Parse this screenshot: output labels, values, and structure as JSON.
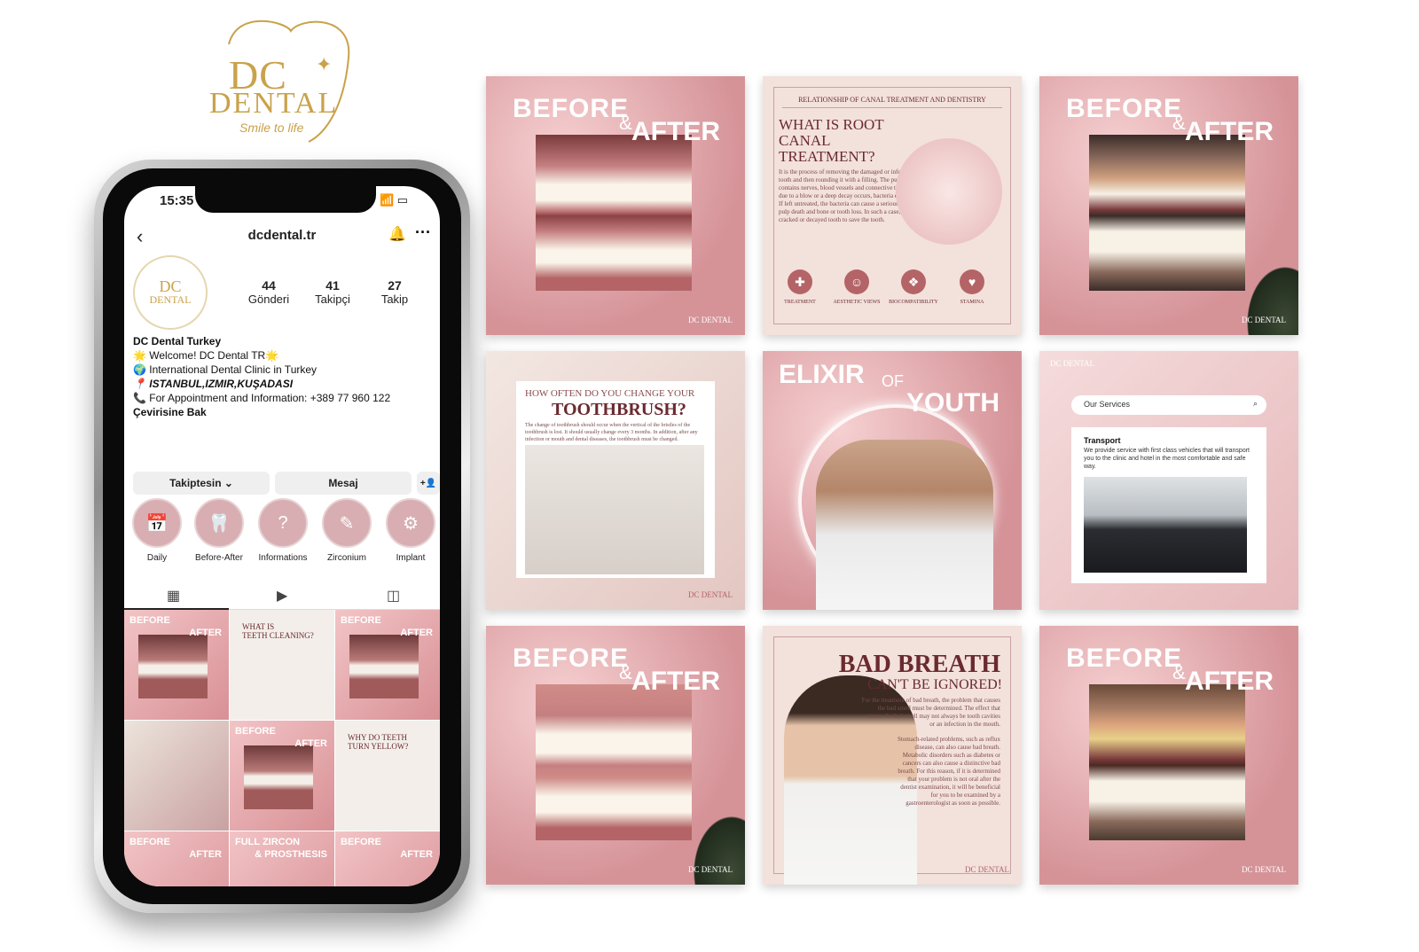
{
  "logo": {
    "monogram": "DC",
    "word": "DENTAL",
    "tagline": "Smile to life",
    "sparkle": "✦"
  },
  "phone": {
    "time": "15:35",
    "status_icons": "📶 ▭",
    "back": "‹",
    "handle": "dcdental.tr",
    "avatar": {
      "line1": "DC",
      "line2": "DENTAL"
    },
    "stats": [
      {
        "value": "44",
        "label": "Gönderi"
      },
      {
        "value": "41",
        "label": "Takipçi"
      },
      {
        "value": "27",
        "label": "Takip"
      }
    ],
    "bio": {
      "name": "DC Dental Turkey",
      "line1": "🌟 Welcome! DC Dental TR🌟",
      "line2": "🌍 International Dental Clinic in Turkey",
      "line3": "📍 ISTANBUL,IZMIR,KUŞADASI",
      "line4": "📞 For Appointment and Information: +389 77 960 122",
      "translate": "Çevirisine Bak"
    },
    "buttons": {
      "follow": "Takiptesin ⌄",
      "message": "Mesaj",
      "add": "+👤"
    },
    "highlights": [
      {
        "label": "Daily",
        "icon": "📅"
      },
      {
        "label": "Before-After",
        "icon": "🦷"
      },
      {
        "label": "Informations",
        "icon": "?"
      },
      {
        "label": "Zirconium",
        "icon": "✎"
      },
      {
        "label": "Implant",
        "icon": "⚙"
      }
    ],
    "tabs": {
      "grid": "▦",
      "reels": "▶",
      "tagged": "◫"
    },
    "grid": [
      {
        "l1": "BEFORE",
        "l2": "AFTER"
      },
      {
        "l1": "WHAT IS",
        "l2": "TEETH CLEANING?"
      },
      {
        "l1": "BEFORE",
        "l2": "AFTER"
      },
      {
        "l1": "",
        "l2": ""
      },
      {
        "l1": "BEFORE",
        "l2": "AFTER"
      },
      {
        "l1": "WHY DO TEETH",
        "l2": "TURN YELLOW?"
      },
      {
        "l1": "BEFORE",
        "l2": "AFTER"
      },
      {
        "l1": "FULL ZIRCON",
        "l2": "& PROSTHESIS"
      },
      {
        "l1": "BEFORE",
        "l2": "AFTER"
      }
    ]
  },
  "posts": {
    "before": "BEFORE",
    "amp": "&",
    "after": "AFTER",
    "mark": "DC DENTAL",
    "root": {
      "banner": "RELATIONSHIP OF CANAL TREATMENT AND DENTISTRY",
      "title": "WHAT IS ROOT CANAL TREATMENT?",
      "body": "It is the process of removing the damaged or infected pulp of a tooth, disinfecting the tooth and then rounding it with a filling. The pulp extends to the root tip of the teeth and contains nerves, blood vessels and connective tissue. In cases where the tooth is cracked due to a blow or a deep decay occurs, bacteria enter the pulp and begin to multiply there. If left untreated, the bacteria can cause a serious infection or dental abscess, leading to pulp death and bone or tooth loss. In such a case, canal treatment is applied to the cracked or decayed tooth to save the tooth.",
      "icons": [
        "TREATMENT",
        "AESTHETIC VIEWS",
        "BIOCOMPATIBILITY",
        "STAMINA"
      ]
    },
    "brush": {
      "q1": "HOW OFTEN DO YOU CHANGE YOUR",
      "q2": "TOOTHBRUSH?",
      "body": "The change of toothbrush should occur when the vertical of the bristles of the toothbrush is lost. It should usually change every 3 months. In addition, after any infection or mouth and dental diseases, the toothbrush must be changed."
    },
    "elixir": {
      "w1": "ELIXIR",
      "w2": "OF",
      "w3": "YOUTH"
    },
    "services": {
      "search": "Our Services",
      "title": "Transport",
      "body": "We provide service with first class vehicles that will transport you to the clinic and hotel in the most comfortable and safe way."
    },
    "breath": {
      "title": "BAD BREATH",
      "sub": "CAN'T BE IGNORED!",
      "body1": "For the treatment of bad breath, the problem that causes the bad smell must be determined. The effect that causes the bad smell may not always be tooth cavities or an infection in the mouth.",
      "body2": "Stomach-related problems, such as reflux disease, can also cause bad breath. Metabolic disorders such as diabetes or cancers can also cause a distinctive bad breath. For this reason, if it is determined that your problem is not oral after the dentist examination, it will be beneficial for you to be examined by a gastroenterologist as soon as possible."
    }
  }
}
